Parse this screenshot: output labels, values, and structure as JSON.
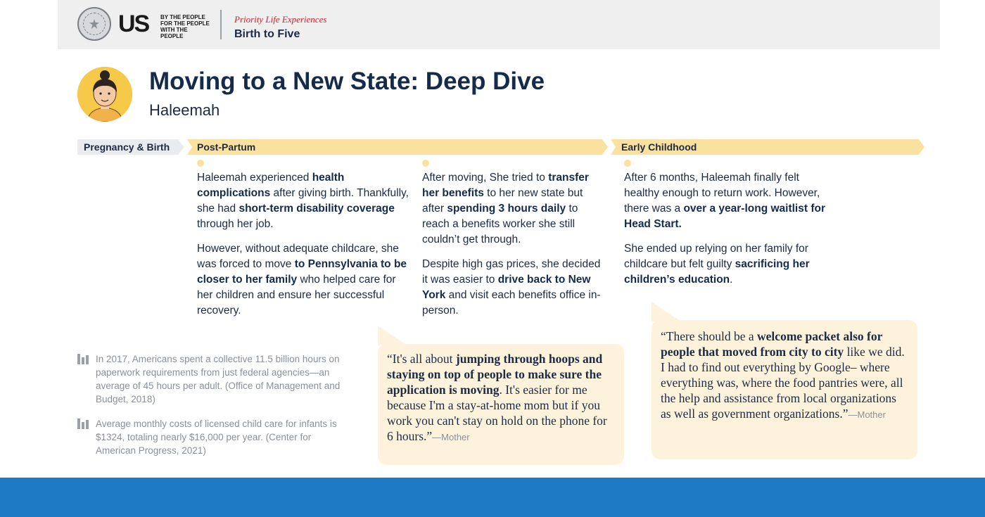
{
  "header": {
    "brand": "US",
    "tagline": [
      "BY THE PEOPLE",
      "FOR THE PEOPLE",
      "WITH THE PEOPLE"
    ],
    "series": "Priority Life Experiences",
    "section": "Birth to Five"
  },
  "title": "Moving to a New State: Deep Dive",
  "persona": "Haleemah",
  "timeline": {
    "phases": [
      "Pregnancy & Birth",
      "Post-Partum",
      "Early Childhood"
    ]
  },
  "columns": {
    "c1": {
      "p1": [
        "Haleemah experienced ",
        "health complications",
        " after giving birth. Thankfully, she had ",
        "short-term disability coverage",
        " through her job."
      ],
      "p2": [
        "However, without adequate childcare, she was forced to  move ",
        "to Pennsylvania to be closer to her family",
        " who helped care for her children and ensure her successful recovery."
      ]
    },
    "c2": {
      "p1": [
        "After moving, She tried to ",
        "transfer her benefits",
        " to her new state but after ",
        "spending 3 hours daily",
        " to reach a benefits worker she still couldn’t get through."
      ],
      "p2": [
        "Despite high gas prices, she decided it was easier to ",
        "drive back to New York",
        "  and visit each benefits office in-person."
      ]
    },
    "c3": {
      "p1": [
        "After 6 months, Haleemah finally felt healthy enough to return work. However, there was a ",
        "over a year-long waitlist for Head Start."
      ],
      "p2": [
        "She ended up relying on her family for childcare but felt guilty ",
        "sacrificing her children’s education",
        "."
      ]
    }
  },
  "stats": [
    "In 2017, Americans spent a collective 11.5 billion hours on paperwork requirements from just federal agencies—an average of 45 hours per adult. (Office of Management and Budget, 2018)",
    "Average monthly costs of licensed child care for infants is $1324, totaling nearly $16,000 per year. (Center for American Progress, 2021)"
  ],
  "quotes": {
    "q1": {
      "parts": [
        "“It's all about ",
        "jumping through hoops and staying on top of people to make sure the application is moving",
        ". It's easier for me because I'm a stay-at-home mom but if you work you can't stay on hold on the phone for 6 hours.”"
      ],
      "attribution": "—Mother"
    },
    "q2": {
      "parts": [
        "“There should be a ",
        "welcome packet also for people that moved from city to city",
        " like we did. I had to find out everything by Google– where everything was, where the food pantries were, all the help and assistance from local organizations as well as government organizations.”"
      ],
      "attribution": "—Mother"
    }
  },
  "colors": {
    "navy": "#142b4c",
    "phase_yellow": "#fbe19f",
    "quote_bg": "#fdf3dc",
    "footer_blue": "#1f7ac4",
    "avatar_yellow": "#f7c948"
  }
}
